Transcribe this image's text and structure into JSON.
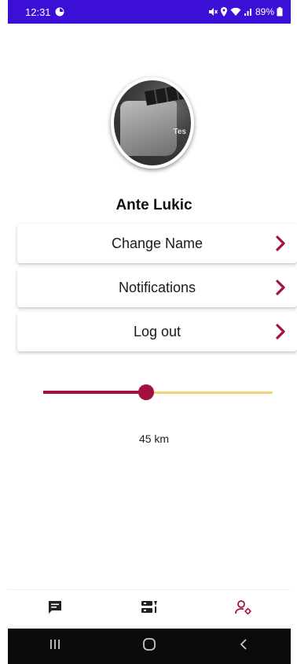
{
  "status_bar": {
    "time": "12:31",
    "battery": "89%",
    "icons": [
      "app-notification-icon",
      "mute-icon",
      "location-icon",
      "wifi-icon",
      "signal-icon",
      "battery-icon"
    ]
  },
  "profile": {
    "name": "Ante Lukic",
    "avatar_text": "Tes"
  },
  "menu": [
    {
      "label": "Change Name",
      "icon": "chevron-right-icon"
    },
    {
      "label": "Notifications",
      "icon": "chevron-right-icon"
    },
    {
      "label": "Log out",
      "icon": "chevron-right-icon"
    }
  ],
  "distance_slider": {
    "value_label": "45 km",
    "fraction": 0.45
  },
  "bottom_nav": {
    "items": [
      "chat-icon",
      "map-filter-icon",
      "user-settings-icon"
    ]
  },
  "system_nav": {
    "items": [
      "recent-apps-icon",
      "home-icon",
      "back-icon"
    ]
  },
  "colors": {
    "status_bar": "#3b0fd6",
    "accent": "#a3113e",
    "slider_track": "#f3d57a",
    "system_nav": "#0b0b0b"
  }
}
